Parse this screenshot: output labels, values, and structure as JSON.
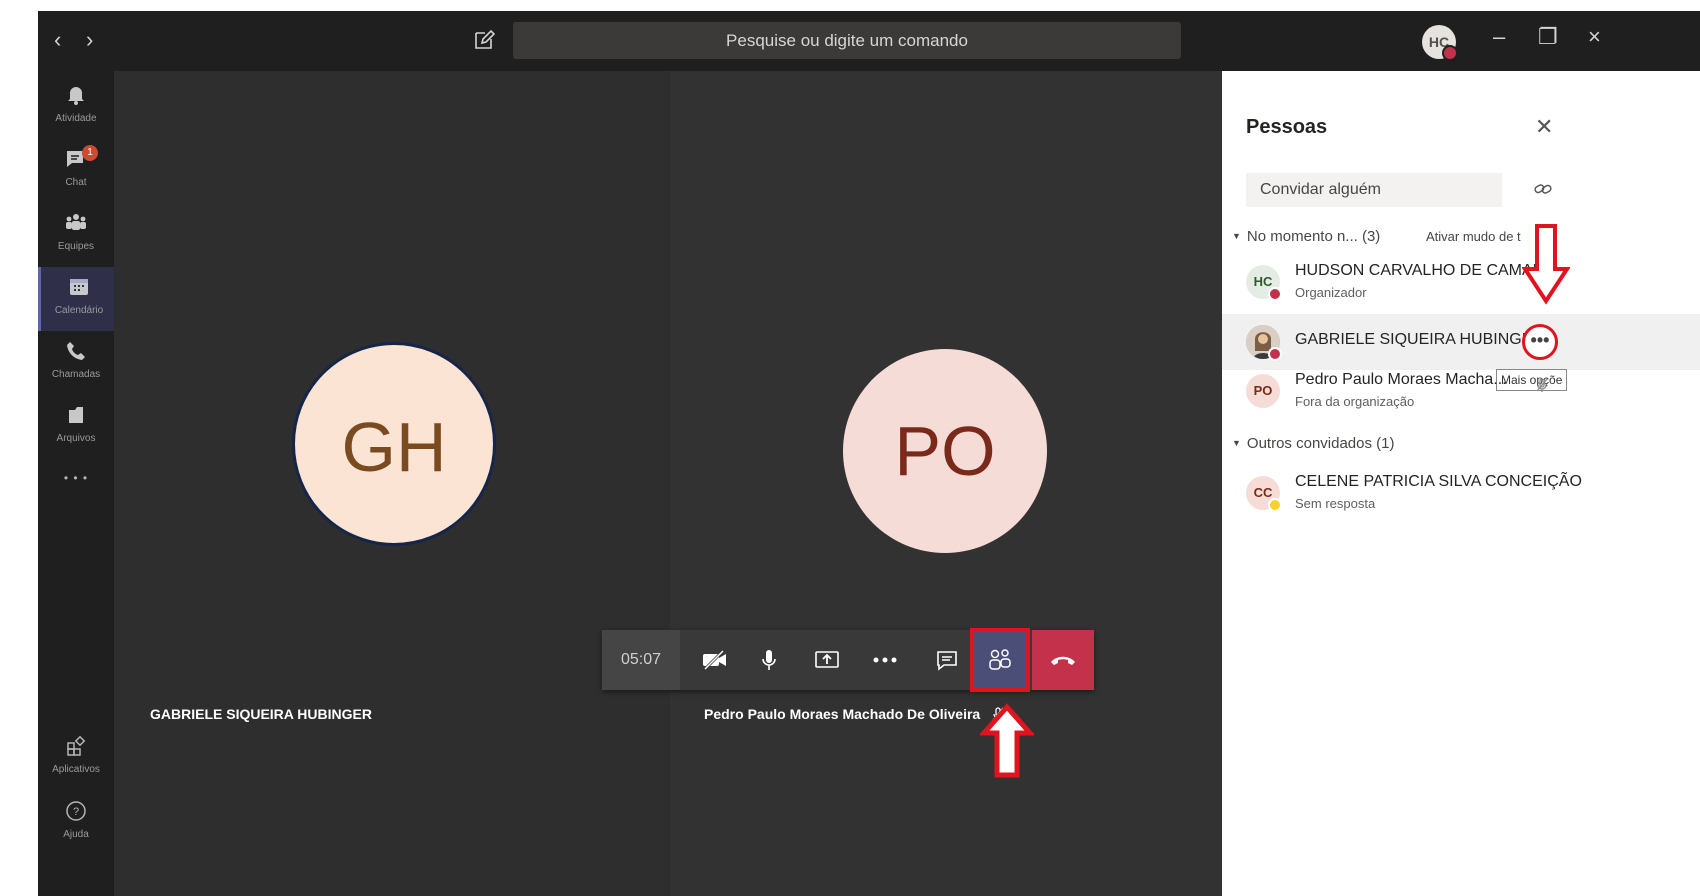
{
  "topbar": {
    "back": "‹",
    "forward": "›",
    "search_placeholder": "Pesquise ou digite um comando",
    "user_initials": "HC",
    "minimize": "–",
    "maximize": "❐",
    "close": "×"
  },
  "rail": {
    "items": [
      {
        "label": "Atividade",
        "icon": "bell-icon"
      },
      {
        "label": "Chat",
        "icon": "chat-icon",
        "badge": "1"
      },
      {
        "label": "Equipes",
        "icon": "teams-icon"
      },
      {
        "label": "Calendário",
        "icon": "calendar-icon"
      },
      {
        "label": "Chamadas",
        "icon": "phone-icon"
      },
      {
        "label": "Arquivos",
        "icon": "files-icon"
      }
    ],
    "more": "• • •",
    "apps_label": "Aplicativos",
    "help_label": "Ajuda"
  },
  "stage": {
    "left_initials": "GH",
    "left_name": "GABRIELE SIQUEIRA HUBINGER",
    "right_initials": "PO",
    "right_name": "Pedro Paulo Moraes Machado De Oliveira"
  },
  "callbar": {
    "timer": "05:07"
  },
  "panel": {
    "title": "Pessoas",
    "invite_placeholder": "Convidar alguém",
    "section_current": "No momento n...  (3)",
    "mute_all": "Ativar mudo de t",
    "section_others": "Outros convidados (1)",
    "participants": [
      {
        "initials": "HC",
        "name": "HUDSON CARVALHO DE CAMAR",
        "sub": "Organizador",
        "status_color": "#c4314b"
      },
      {
        "initials": "",
        "name": "GABRIELE SIQUEIRA HUBINGER",
        "sub": "",
        "status_color": "#c4314b"
      },
      {
        "initials": "PO",
        "name": "Pedro Paulo Moraes Macha...",
        "sub": "Fora da organização",
        "status_color": ""
      }
    ],
    "others": [
      {
        "initials": "CC",
        "name": "CELENE PATRICIA SILVA CONCEIÇÃO",
        "sub": "Sem resposta",
        "status_color": "#f8d22a"
      }
    ],
    "more_options_label": "•••",
    "tooltip": "Mais opçõe"
  },
  "colors": {
    "accent": "#6264a7",
    "hangup": "#c4314b",
    "highlight_red": "#e0141e"
  }
}
